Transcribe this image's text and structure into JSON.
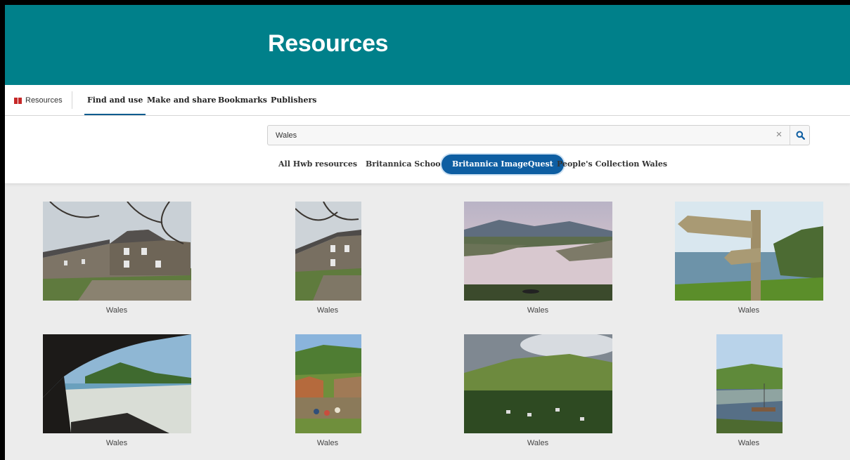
{
  "header": {
    "title": "Resources"
  },
  "subnav": {
    "brand_label": "Resources",
    "links": [
      "Find and use",
      "Make and share",
      "Bookmarks",
      "Publishers"
    ]
  },
  "search": {
    "value": "Wales",
    "clear_symbol": "×"
  },
  "tabs": [
    "All Hwb resources",
    "Britannica School",
    "Britannica ImageQuest",
    "People's Collection Wales"
  ],
  "selected_tab": "Britannica ImageQuest",
  "results": [
    {
      "caption": "Wales",
      "image": "stone-terraced-houses-landscape"
    },
    {
      "caption": "Wales",
      "image": "stone-houses-portrait"
    },
    {
      "caption": "Wales",
      "image": "river-estuary-mountains"
    },
    {
      "caption": "Wales",
      "image": "coastal-path-signpost"
    },
    {
      "caption": "Wales",
      "image": "beach-from-cave"
    },
    {
      "caption": "Wales",
      "image": "farm-visitors"
    },
    {
      "caption": "Wales",
      "image": "hillside-village"
    },
    {
      "caption": "Wales",
      "image": "harbour-boats-portrait"
    }
  ],
  "colors": {
    "banner": "#00808a",
    "accent": "#0e5ea2",
    "background": "#ececec"
  }
}
